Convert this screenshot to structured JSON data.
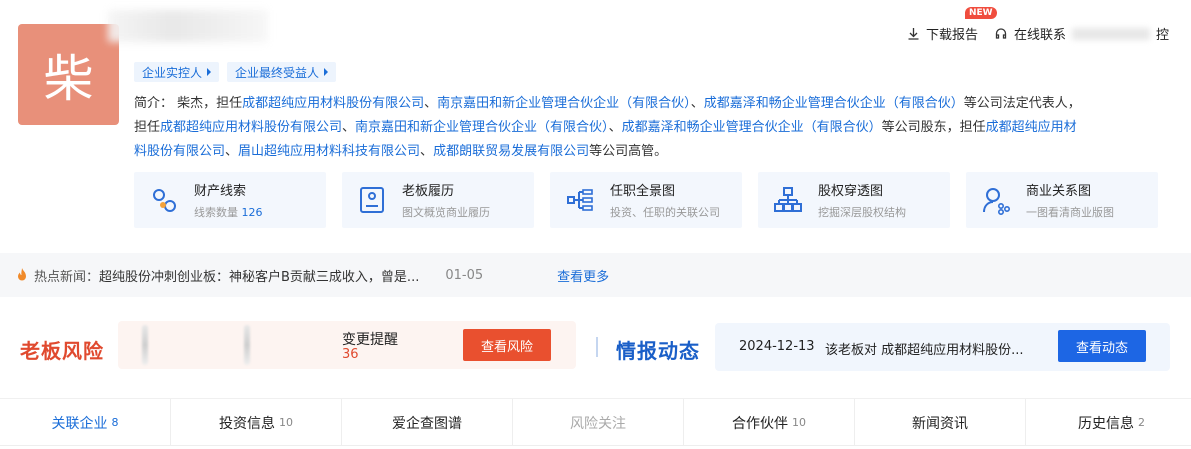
{
  "profile": {
    "avatar_char": "柴",
    "tags": [
      "企业实控人",
      "企业最终受益人"
    ]
  },
  "actions": {
    "download_label": "下载报告",
    "new_badge": "NEW",
    "contact_prefix": "在线联系",
    "contact_suffix": "控"
  },
  "description": {
    "line1_prefix": "简介：  柴杰，担任",
    "line1_links": [
      "成都超纯应用材料股份有限公司",
      "南京嘉田和新企业管理合伙企业（有限合伙）",
      "成都嘉泽和畅企业管理合伙企业（有限合伙）"
    ],
    "line1_sep": "、",
    "line1_suffix": "等公司法定代表人，",
    "line2_prefix": "担任",
    "line2_links": [
      "成都超纯应用材料股份有限公司",
      "南京嘉田和新企业管理合伙企业（有限合伙）",
      "成都嘉泽和畅企业管理合伙企业（有限合伙）"
    ],
    "line2_suffix": "等公司股东，担任",
    "line2_link_tail": "成都超纯应用材",
    "line3_link_head": "料股份有限公司",
    "line3_links": [
      "眉山超纯应用材料科技有限公司",
      "成都朗联贸易发展有限公司"
    ],
    "line3_suffix": "等公司高管。"
  },
  "cards": [
    {
      "title": "财产线索",
      "sub_label": "线索数量",
      "sub_num": "126",
      "icon": "asset-clue-icon"
    },
    {
      "title": "老板履历",
      "sub_label": "图文概览商业履历",
      "sub_num": "",
      "icon": "resume-icon"
    },
    {
      "title": "任职全景图",
      "sub_label": "投资、任职的关联公司",
      "sub_num": "",
      "icon": "position-map-icon"
    },
    {
      "title": "股权穿透图",
      "sub_label": "挖掘深层股权结构",
      "sub_num": "",
      "icon": "equity-tree-icon"
    },
    {
      "title": "商业关系图",
      "sub_label": "一图看清商业版图",
      "sub_num": "",
      "icon": "business-relation-icon"
    }
  ],
  "news": {
    "label": "热点新闻：",
    "text": "超纯股份冲刺创业板：神秘客户B贡献三成收入，曾是...",
    "date": "01-05",
    "more": "查看更多"
  },
  "risk": {
    "title": "老板风险",
    "change_label": "变更提醒",
    "change_value": "36",
    "button": "查看风险"
  },
  "intel": {
    "title": "情报动态",
    "date": "2024-12-13",
    "content": "该老板对 成都超纯应用材料股份...",
    "button": "查看动态"
  },
  "tabs": [
    {
      "label": "关联企业",
      "count": "8"
    },
    {
      "label": "投资信息",
      "count": "10"
    },
    {
      "label": "爱企查图谱",
      "count": ""
    },
    {
      "label": "风险关注",
      "count": ""
    },
    {
      "label": "合作伙伴",
      "count": "10"
    },
    {
      "label": "新闻资讯",
      "count": ""
    },
    {
      "label": "历史信息",
      "count": "2"
    }
  ],
  "colors": {
    "accent_blue": "#1a6dd8",
    "risk_red": "#e9502f",
    "intel_blue": "#1d66e4"
  }
}
